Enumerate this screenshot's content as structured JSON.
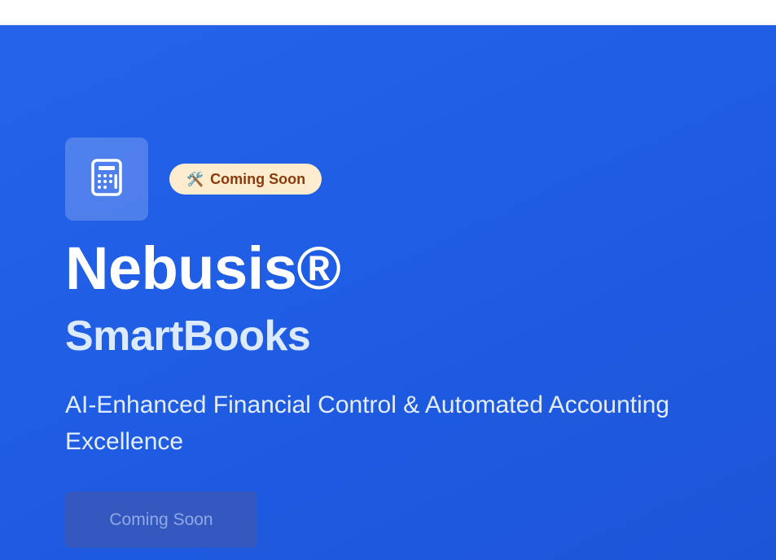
{
  "hero": {
    "icon": "calculator-icon",
    "badge": {
      "icon": "hammer-and-wrench-icon",
      "emoji": "🛠️",
      "label": "Coming Soon",
      "background": "#fdeccd",
      "text_color": "#8a3a0c"
    },
    "brand": "Nebusis®",
    "product": "SmartBooks",
    "tagline": "AI-Enhanced Financial Control & Automated Accounting Excellence",
    "cta_label": "Coming Soon"
  },
  "colors": {
    "hero_background": "#2563eb",
    "product_text": "#dbeafe",
    "cta_background": "#3458be",
    "cta_text": "#8fa8e8"
  }
}
